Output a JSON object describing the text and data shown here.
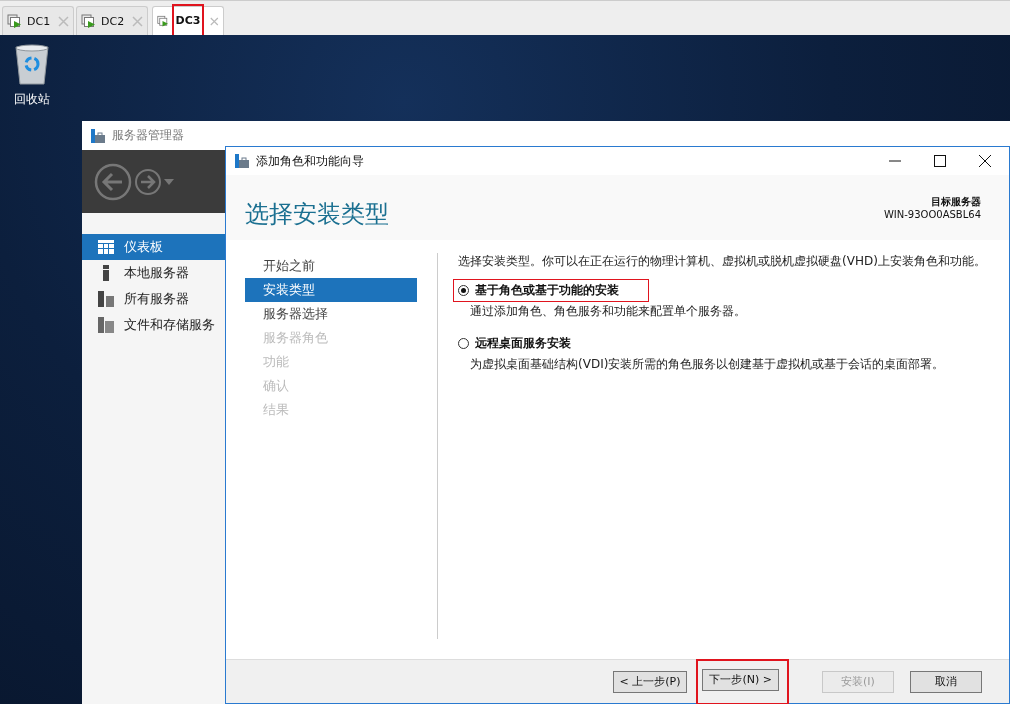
{
  "tabs": [
    {
      "label": "DC1",
      "selected": false,
      "highlighted": false
    },
    {
      "label": "DC2",
      "selected": false,
      "highlighted": false
    },
    {
      "label": "DC3",
      "selected": true,
      "highlighted": true
    }
  ],
  "desktop": {
    "recycle_bin_label": "回收站"
  },
  "server_manager": {
    "title": "服务器管理器",
    "sidebar": [
      {
        "label": "仪表板",
        "selected": true,
        "kind": "dashboard"
      },
      {
        "label": "本地服务器",
        "selected": false,
        "kind": "local"
      },
      {
        "label": "所有服务器",
        "selected": false,
        "kind": "all"
      },
      {
        "label": "文件和存储服务",
        "selected": false,
        "kind": "files"
      }
    ]
  },
  "wizard": {
    "title": "添加角色和功能向导",
    "heading": "选择安装类型",
    "target_label": "目标服务器",
    "target_server": "WIN-93OO0ASBL64",
    "steps": [
      {
        "label": "开始之前",
        "selected": false,
        "disabled": false
      },
      {
        "label": "安装类型",
        "selected": true,
        "disabled": false
      },
      {
        "label": "服务器选择",
        "selected": false,
        "disabled": false
      },
      {
        "label": "服务器角色",
        "selected": false,
        "disabled": true
      },
      {
        "label": "功能",
        "selected": false,
        "disabled": true
      },
      {
        "label": "确认",
        "selected": false,
        "disabled": true
      },
      {
        "label": "结果",
        "selected": false,
        "disabled": true
      }
    ],
    "description": "选择安装类型。你可以在正在运行的物理计算机、虚拟机或脱机虚拟硬盘(VHD)上安装角色和功能。",
    "options": [
      {
        "label": "基于角色或基于功能的安装",
        "detail": "通过添加角色、角色服务和功能来配置单个服务器。",
        "selected": true,
        "highlighted": true
      },
      {
        "label": "远程桌面服务安装",
        "detail": "为虚拟桌面基础结构(VDI)安装所需的角色服务以创建基于虚拟机或基于会话的桌面部署。",
        "selected": false,
        "highlighted": false
      }
    ],
    "buttons": [
      {
        "label": "< 上一步(P)",
        "disabled": false,
        "highlighted": false
      },
      {
        "label": "下一步(N) >",
        "disabled": false,
        "highlighted": true
      },
      {
        "label": "安装(I)",
        "disabled": true,
        "highlighted": false
      },
      {
        "label": "取消",
        "disabled": false,
        "highlighted": false
      }
    ]
  }
}
